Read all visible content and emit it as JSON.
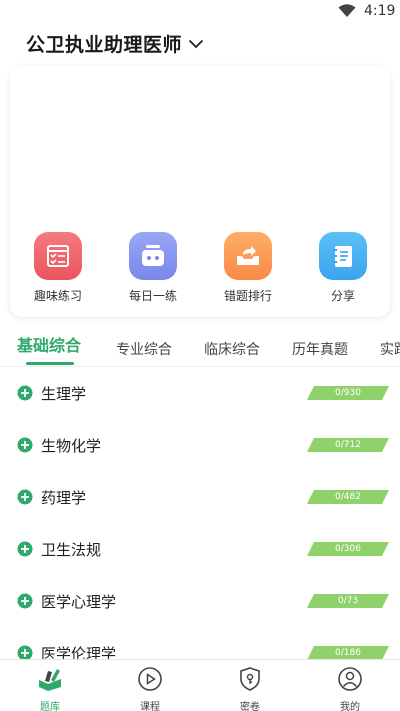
{
  "status_bar": {
    "time": "4:19"
  },
  "header": {
    "title": "公卫执业助理医师"
  },
  "quick_actions": [
    {
      "label": "趣味练习",
      "icon": "checklist-icon",
      "color": "#e9545c"
    },
    {
      "label": "每日一练",
      "icon": "robot-face-icon",
      "color": "#7a87ea"
    },
    {
      "label": "错题排行",
      "icon": "share-box-icon",
      "color": "#f98a45"
    },
    {
      "label": "分享",
      "icon": "notebook-icon",
      "color": "#3aa4ee"
    }
  ],
  "tabs": [
    {
      "label": "基础综合",
      "active": true
    },
    {
      "label": "专业综合"
    },
    {
      "label": "临床综合"
    },
    {
      "label": "历年真题"
    },
    {
      "label": "实践"
    }
  ],
  "subjects": [
    {
      "name": "生理学",
      "progress": "0/930"
    },
    {
      "name": "生物化学",
      "progress": "0/712"
    },
    {
      "name": "药理学",
      "progress": "0/482"
    },
    {
      "name": "卫生法规",
      "progress": "0/306"
    },
    {
      "name": "医学心理学",
      "progress": "0/73"
    },
    {
      "name": "医学伦理学",
      "progress": "0/186"
    }
  ],
  "bottom_nav": [
    {
      "label": "题库",
      "icon": "question-bank-icon",
      "active": true
    },
    {
      "label": "课程",
      "icon": "play-circle-icon"
    },
    {
      "label": "密卷",
      "icon": "shield-key-icon"
    },
    {
      "label": "我的",
      "icon": "user-profile-icon"
    }
  ],
  "colors": {
    "accent": "#2fa86b",
    "badge": "#8fd16a"
  }
}
